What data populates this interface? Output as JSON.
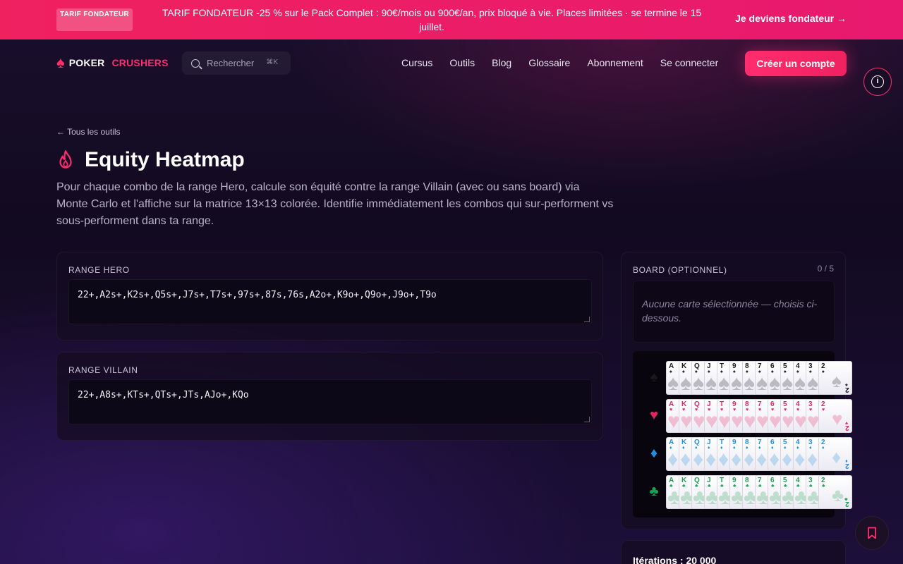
{
  "promo": {
    "badge": "TARIF FONDATEUR",
    "text": "TARIF FONDATEUR -25 % sur le Pack Complet : 90€/mois ou 900€/an, prix bloqué à vie. Places limitées · se termine le 15 juillet.",
    "cta": "Je deviens fondateur →"
  },
  "header": {
    "logo_part1": "POKER",
    "logo_part2": "CRUSHERS",
    "search_placeholder": "Rechercher",
    "search_shortcut": "⌘K",
    "nav": [
      "Cursus",
      "Outils",
      "Blog",
      "Glossaire",
      "Abonnement",
      "Se connecter"
    ],
    "signup": "Créer un compte"
  },
  "page": {
    "back_link": "← Tous les outils",
    "title": "Equity Heatmap",
    "description": "Pour chaque combo de la range Hero, calcule son équité contre la range Villain (avec ou sans board) via Monte Carlo et l'affiche sur la matrice 13×13 colorée. Identifie immédiatement les combos qui sur-performent vs sous-performent dans ta range."
  },
  "hero": {
    "label": "RANGE HERO",
    "value": "22+,A2s+,K2s+,Q5s+,J7s+,T7s+,97s+,87s,76s,A2o+,K9o+,Q9o+,J9o+,T9o"
  },
  "villain": {
    "label": "RANGE VILLAIN",
    "value": "22+,A8s+,KTs+,QTs+,JTs,AJo+,KQo"
  },
  "board": {
    "label": "BOARD (OPTIONNEL)",
    "count": "0 / 5",
    "empty_text": "Aucune carte sélectionnée — choisis ci-dessous.",
    "ranks": [
      "A",
      "K",
      "Q",
      "J",
      "T",
      "9",
      "8",
      "7",
      "6",
      "5",
      "4",
      "3",
      "2"
    ],
    "suits": [
      {
        "symbol": "♠",
        "name": "spade",
        "color": "#1a1a1a"
      },
      {
        "symbol": "♥",
        "name": "heart",
        "color": "#e8245f"
      },
      {
        "symbol": "♦",
        "name": "diamond",
        "color": "#1f8fe0"
      },
      {
        "symbol": "♣",
        "name": "club",
        "color": "#1e9e55"
      }
    ]
  },
  "iterations": {
    "label": "Itérations : 20 000"
  },
  "colors": {
    "accent": "#ff2d6e",
    "banner": "#f0215f"
  }
}
